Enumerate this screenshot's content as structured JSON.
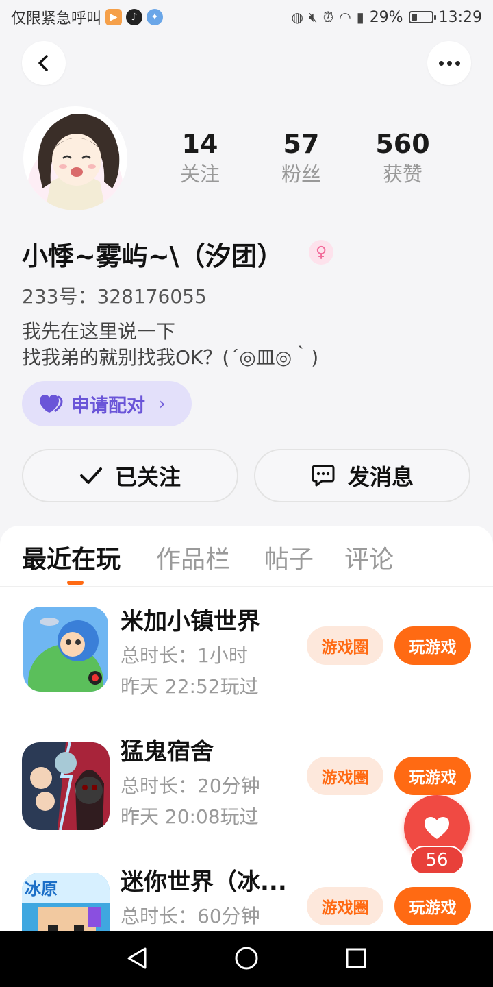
{
  "status_bar": {
    "carrier_text": "仅限紧急呼叫",
    "battery": "29%",
    "battery_level": 0.29,
    "time": "13:29"
  },
  "header": {
    "back_icon": "chevron-left-icon",
    "more_icon": "more-dots-icon"
  },
  "profile": {
    "stats": [
      {
        "value": "14",
        "label": "关注"
      },
      {
        "value": "57",
        "label": "粉丝"
      },
      {
        "value": "560",
        "label": "获赞"
      }
    ],
    "name": "小悸~雾屿~\\（汐团）",
    "gender_symbol": "♀",
    "uid_text": "233号：328176055",
    "bio_lines": [
      "我先在这里说一下",
      "找我弟的就别找我OK？(´◎皿◎｀)"
    ],
    "pair_button_label": "申请配对",
    "follow_button_label": "已关注",
    "message_button_label": "发消息"
  },
  "tabs": [
    {
      "label": "最近在玩",
      "active": true
    },
    {
      "label": "作品栏",
      "active": false
    },
    {
      "label": "帖子",
      "active": false
    },
    {
      "label": "评论",
      "active": false
    }
  ],
  "games": [
    {
      "title": "米加小镇世界",
      "duration": "总时长：1小时",
      "last_played": "昨天 22:52玩过",
      "circle_label": "游戏圈",
      "play_label": "玩游戏"
    },
    {
      "title": "猛鬼宿舍",
      "duration": "总时长：20分钟",
      "last_played": "昨天 20:08玩过",
      "circle_label": "游戏圈",
      "play_label": "玩游戏"
    },
    {
      "title": "迷你世界（冰...",
      "duration": "总时长：60分钟",
      "last_played": "",
      "circle_label": "游戏圈",
      "play_label": "玩游戏",
      "icon_text": "冰原"
    }
  ],
  "like_fab": {
    "count": "56"
  },
  "colors": {
    "accent": "#ff6a13",
    "pair_purple": "#6a55d8",
    "like_red": "#f04a43"
  }
}
